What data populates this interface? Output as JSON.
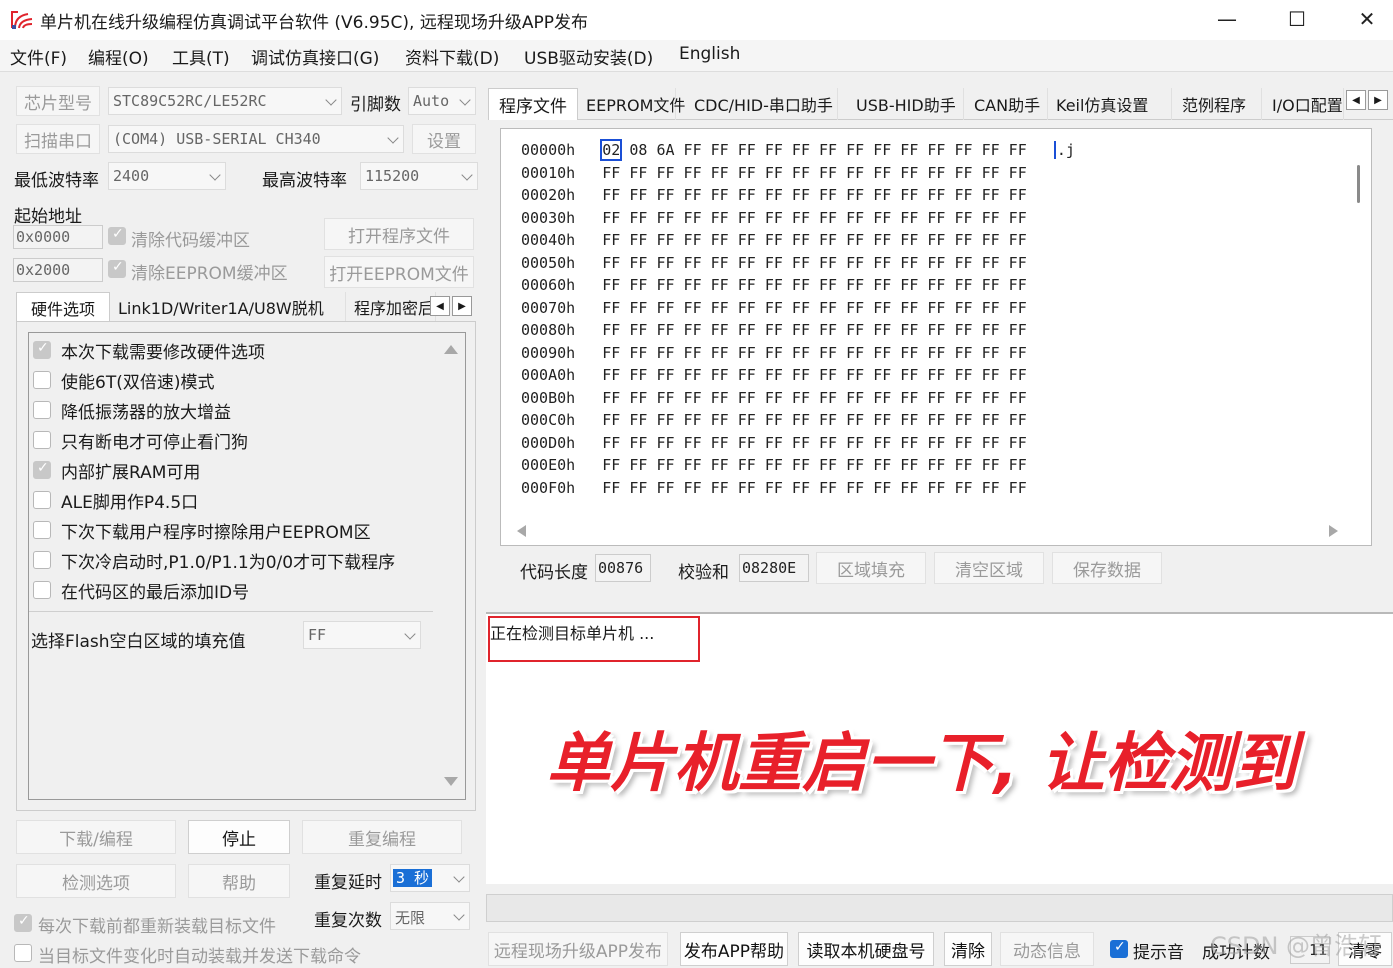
{
  "window": {
    "title": "单片机在线升级编程仿真调试平台软件 (V6.95C), 远程现场升级APP发布",
    "minimize": "—",
    "maximize": "☐",
    "close": "✕"
  },
  "menu": [
    "文件(F)",
    "编程(O)",
    "工具(T)",
    "调试仿真接口(G)",
    "资料下载(D)",
    "USB驱动安装(D)",
    "English"
  ],
  "left": {
    "chip_label": "芯片型号",
    "chip_value": "STC89C52RC/LE52RC",
    "pins_label": "引脚数",
    "pins_value": "Auto",
    "scan_label": "扫描串口",
    "port_value": "(COM4) USB-SERIAL CH340",
    "settings_btn": "设置",
    "min_baud_label": "最低波特率",
    "min_baud_value": "2400",
    "max_baud_label": "最高波特率",
    "max_baud_value": "115200",
    "start_addr_label": "起始地址",
    "addr1": "0x0000",
    "addr2": "0x2000",
    "clear_code_label": "清除代码缓冲区",
    "clear_eeprom_label": "清除EEPROM缓冲区",
    "open_prog_btn": "打开程序文件",
    "open_eeprom_btn": "打开EEPROM文件",
    "tabs": [
      "硬件选项",
      "Link1D/Writer1A/U8W脱机",
      "程序加密后"
    ],
    "options": [
      "本次下载需要修改硬件选项",
      "使能6T(双倍速)模式",
      "降低振荡器的放大增益",
      "只有断电才可停止看门狗",
      "内部扩展RAM可用",
      "ALE脚用作P4.5口",
      "下次下载用户程序时擦除用户EEPROM区",
      "下次冷启动时,P1.0/P1.1为0/0才可下载程序",
      "在代码区的最后添加ID号"
    ],
    "fill_label": "选择Flash空白区域的填充值",
    "fill_value": "FF",
    "download_btn": "下载/编程",
    "stop_btn": "停止",
    "reprogram_btn": "重复编程",
    "check_btn": "检测选项",
    "help_btn": "帮助",
    "repeat_delay_label": "重复延时",
    "repeat_delay_value": "3 秒",
    "repeat_count_label": "重复次数",
    "repeat_count_value": "无限",
    "reload_label": "每次下载前都重新装载目标文件",
    "auto_label": "当目标文件变化时自动装载并发送下载命令"
  },
  "right": {
    "tabs": [
      "程序文件",
      "EEPROM文件",
      "CDC/HID-串口助手",
      "USB-HID助手",
      "CAN助手",
      "Keil仿真设置",
      "范例程序",
      "I/O口配置"
    ],
    "hex_rows": [
      {
        "addr": "00000h",
        "first": "02",
        "rest": "08 6A FF FF FF FF FF FF FF FF FF FF FF FF FF",
        "ascii": ".j"
      },
      {
        "addr": "00010h",
        "bytes": "FF FF FF FF FF FF FF FF FF FF FF FF FF FF FF FF"
      },
      {
        "addr": "00020h",
        "bytes": "FF FF FF FF FF FF FF FF FF FF FF FF FF FF FF FF"
      },
      {
        "addr": "00030h",
        "bytes": "FF FF FF FF FF FF FF FF FF FF FF FF FF FF FF FF"
      },
      {
        "addr": "00040h",
        "bytes": "FF FF FF FF FF FF FF FF FF FF FF FF FF FF FF FF"
      },
      {
        "addr": "00050h",
        "bytes": "FF FF FF FF FF FF FF FF FF FF FF FF FF FF FF FF"
      },
      {
        "addr": "00060h",
        "bytes": "FF FF FF FF FF FF FF FF FF FF FF FF FF FF FF FF"
      },
      {
        "addr": "00070h",
        "bytes": "FF FF FF FF FF FF FF FF FF FF FF FF FF FF FF FF"
      },
      {
        "addr": "00080h",
        "bytes": "FF FF FF FF FF FF FF FF FF FF FF FF FF FF FF FF"
      },
      {
        "addr": "00090h",
        "bytes": "FF FF FF FF FF FF FF FF FF FF FF FF FF FF FF FF"
      },
      {
        "addr": "000A0h",
        "bytes": "FF FF FF FF FF FF FF FF FF FF FF FF FF FF FF FF"
      },
      {
        "addr": "000B0h",
        "bytes": "FF FF FF FF FF FF FF FF FF FF FF FF FF FF FF FF"
      },
      {
        "addr": "000C0h",
        "bytes": "FF FF FF FF FF FF FF FF FF FF FF FF FF FF FF FF"
      },
      {
        "addr": "000D0h",
        "bytes": "FF FF FF FF FF FF FF FF FF FF FF FF FF FF FF FF"
      },
      {
        "addr": "000E0h",
        "bytes": "FF FF FF FF FF FF FF FF FF FF FF FF FF FF FF FF"
      },
      {
        "addr": "000F0h",
        "bytes": "FF FF FF FF FF FF FF FF FF FF FF FF FF FF FF FF"
      }
    ],
    "code_len_label": "代码长度",
    "code_len_value": "00876",
    "checksum_label": "校验和",
    "checksum_value": "08280E",
    "fill_area_btn": "区域填充",
    "clear_area_btn": "清空区域",
    "save_btn": "保存数据",
    "status_msg": "正在检测目标单片机 ...",
    "overlay_text": "单片机重启一下, 让检测到",
    "bottom_btns": [
      "远程现场升级APP发布",
      "发布APP帮助",
      "读取本机硬盘号",
      "清除",
      "动态信息"
    ],
    "hint_label": "提示音",
    "success_label": "成功计数",
    "success_value": "11",
    "clear_count_btn": "清零",
    "watermark": "CSDN @曾浩轩"
  },
  "colors": {
    "highlight_box": "#e0242c",
    "overlay": "#e8202a",
    "accent": "#1a6fd6"
  }
}
